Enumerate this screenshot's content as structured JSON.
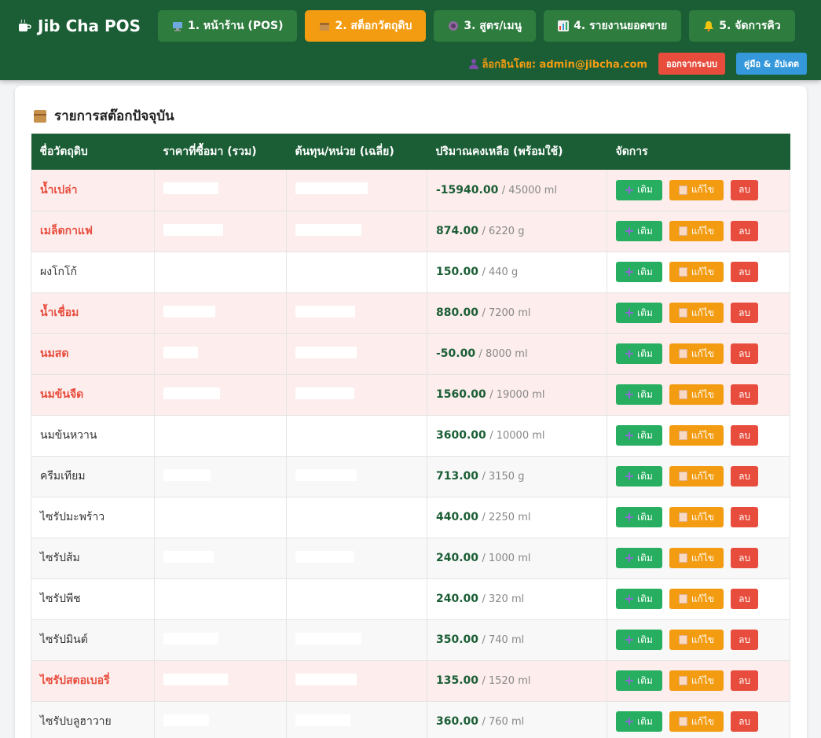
{
  "app": {
    "title": "Jib Cha POS"
  },
  "nav": [
    {
      "label": "1. หน้าร้าน (POS)",
      "icon": "computer-icon",
      "active": false
    },
    {
      "label": "2. สต็อกวัตถุดิบ",
      "icon": "box-icon",
      "active": true
    },
    {
      "label": "3. สูตร/เมนู",
      "icon": "cup-icon",
      "active": false
    },
    {
      "label": "4. รายงานยอดขาย",
      "icon": "chart-icon",
      "active": false
    },
    {
      "label": "5. จัดการคิว",
      "icon": "bell-icon",
      "active": false
    }
  ],
  "user": {
    "login_text": "ล็อกอินโดย: admin@jibcha.com",
    "logout_label": "ออกจากระบบ",
    "manual_label": "คู่มือ & อัปเดต"
  },
  "stock": {
    "title": "รายการสต๊อกปัจจุบัน",
    "columns": [
      "ชื่อวัตถุดิบ",
      "ราคาที่ซื้อมา (รวม)",
      "ต้นทุน/หน่วย (เฉลี่ย)",
      "ปริมาณคงเหลือ (พร้อมใช้)",
      "จัดการ"
    ],
    "actions": {
      "add": "เติม",
      "edit": "แก้ไข",
      "delete": "ลบ"
    },
    "rows": [
      {
        "name": "น้ำเปล่า",
        "low": true,
        "qty": "-15940.00",
        "unit": "/ 45000 ml"
      },
      {
        "name": "เมล็ดกาแฟ",
        "low": true,
        "qty": "874.00",
        "unit": "/ 6220 g"
      },
      {
        "name": "ผงโกโก้",
        "low": false,
        "qty": "150.00",
        "unit": "/ 440 g"
      },
      {
        "name": "น้ำเชื่อม",
        "low": true,
        "qty": "880.00",
        "unit": "/ 7200 ml"
      },
      {
        "name": "นมสด",
        "low": true,
        "qty": "-50.00",
        "unit": "/ 8000 ml"
      },
      {
        "name": "นมข้นจืด",
        "low": true,
        "qty": "1560.00",
        "unit": "/ 19000 ml"
      },
      {
        "name": "นมข้นหวาน",
        "low": false,
        "qty": "3600.00",
        "unit": "/ 10000 ml"
      },
      {
        "name": "ครีมเทียม",
        "low": false,
        "qty": "713.00",
        "unit": "/ 3150 g"
      },
      {
        "name": "ไซรัปมะพร้าว",
        "low": false,
        "qty": "440.00",
        "unit": "/ 2250 ml"
      },
      {
        "name": "ไซรัปส้ม",
        "low": false,
        "qty": "240.00",
        "unit": "/ 1000 ml"
      },
      {
        "name": "ไซรัปพีช",
        "low": false,
        "qty": "240.00",
        "unit": "/ 320 ml"
      },
      {
        "name": "ไซรัปมินต์",
        "low": false,
        "qty": "350.00",
        "unit": "/ 740 ml"
      },
      {
        "name": "ไซรัปสตอเบอรี่",
        "low": true,
        "qty": "135.00",
        "unit": "/ 1520 ml"
      },
      {
        "name": "ไซรัปบลูฮาวาย",
        "low": false,
        "qty": "360.00",
        "unit": "/ 760 ml"
      }
    ]
  },
  "colors": {
    "header_bg": "#1b5e35",
    "nav_bg": "#2e7d3e",
    "nav_active": "#f39c12",
    "add": "#27ae60",
    "edit": "#f39c12",
    "delete": "#e74c3c",
    "low_text": "#e74c3c",
    "low_row": "#fdeded"
  }
}
